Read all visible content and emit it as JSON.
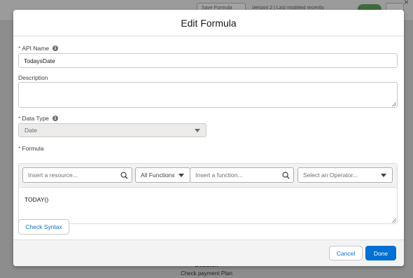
{
  "background": {
    "button_1": "Save Formula",
    "header_text": "Version 2 | Last modified recently",
    "decision_title": "Decision",
    "decision_subtitle": "Check payment Plan"
  },
  "modal": {
    "title": "Edit Formula",
    "api_name": {
      "label": "API Name",
      "value": "TodaysDate"
    },
    "description": {
      "label": "Description",
      "value": ""
    },
    "data_type": {
      "label": "Data Type",
      "value": "Date"
    },
    "formula": {
      "label": "Formula",
      "resource_placeholder": "Insert a resource...",
      "functions_dropdown": "All Functions",
      "function_placeholder": "Insert a function...",
      "operator_placeholder": "Select an Operator...",
      "value": "TODAY()"
    },
    "check_syntax_label": "Check Syntax",
    "cancel_label": "Cancel",
    "done_label": "Done"
  },
  "colors": {
    "brand": "#0070d2",
    "required": "#c23934",
    "overlay": "#8d8d8d"
  },
  "icons": [
    "info-icon",
    "search-icon",
    "chevron-down-icon",
    "close-icon"
  ]
}
